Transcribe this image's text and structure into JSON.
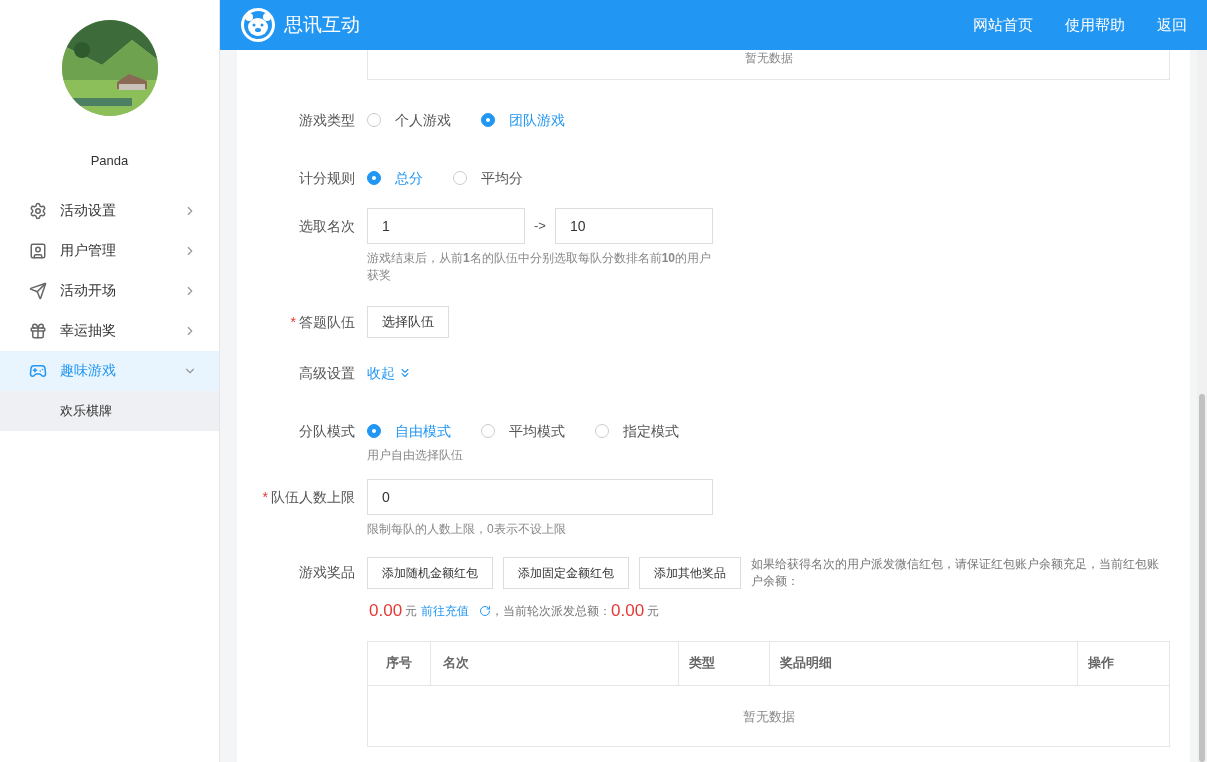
{
  "header": {
    "brand": "思讯互动",
    "nav": [
      "网站首页",
      "使用帮助",
      "返回"
    ]
  },
  "sidebar": {
    "user_name": "Panda",
    "menu": [
      {
        "label": "活动设置",
        "kind": "gears",
        "expanded": false,
        "selected": false
      },
      {
        "label": "用户管理",
        "kind": "user",
        "expanded": false,
        "selected": false
      },
      {
        "label": "活动开场",
        "kind": "plane",
        "expanded": false,
        "selected": false
      },
      {
        "label": "幸运抽奖",
        "kind": "lottery",
        "expanded": false,
        "selected": false
      },
      {
        "label": "趣味游戏",
        "kind": "game",
        "expanded": true,
        "selected": true,
        "children": [
          {
            "label": "欢乐棋牌",
            "selected": false
          }
        ]
      }
    ]
  },
  "top_table": {
    "empty_text": "暂无数据"
  },
  "form": {
    "game_type": {
      "label": "游戏类型",
      "options": [
        {
          "label": "个人游戏",
          "selected": false
        },
        {
          "label": "团队游戏",
          "selected": true
        }
      ]
    },
    "scoring": {
      "label": "计分规则",
      "options": [
        {
          "label": "总分",
          "selected": true
        },
        {
          "label": "平均分",
          "selected": false
        }
      ]
    },
    "rank": {
      "label": "选取名次",
      "from": "1",
      "separator": "->",
      "to": "10",
      "hint": "游戏结束后，从前**1**名的队伍中分别选取每队分数排名前**10**的用户获奖"
    },
    "teams": {
      "label": "答题队伍",
      "required_mark": "*",
      "button": "选择队伍"
    },
    "advanced": {
      "label": "高级设置",
      "toggle": "收起",
      "expanded": true
    },
    "team_mode": {
      "label": "分队模式",
      "options": [
        {
          "label": "自由模式",
          "selected": true
        },
        {
          "label": "平均模式",
          "selected": false
        },
        {
          "label": "指定模式",
          "selected": false
        }
      ],
      "hint": "用户自由选择队伍"
    },
    "team_limit": {
      "label": "队伍人数上限",
      "required_mark": "*",
      "value": "0",
      "hint": "限制每队的人数上限，0表示不设上限"
    },
    "prizes": {
      "label": "游戏奖品",
      "buttons": [
        "添加随机金额红包",
        "添加固定金额红包",
        "添加其他奖品"
      ],
      "note": "如果给获得名次的用户派发微信红包，请保证红包账户余额充足，当前红包账户余额：",
      "balance": "0.00",
      "unit": "元",
      "recharge_link": "前往充值",
      "total_label": "，当前轮次派发总额：",
      "total": "0.00",
      "total_unit": "元",
      "table": {
        "columns": [
          "序号",
          "名次",
          "类型",
          "奖品明细",
          "操作"
        ],
        "empty_text": "暂无数据"
      }
    }
  }
}
